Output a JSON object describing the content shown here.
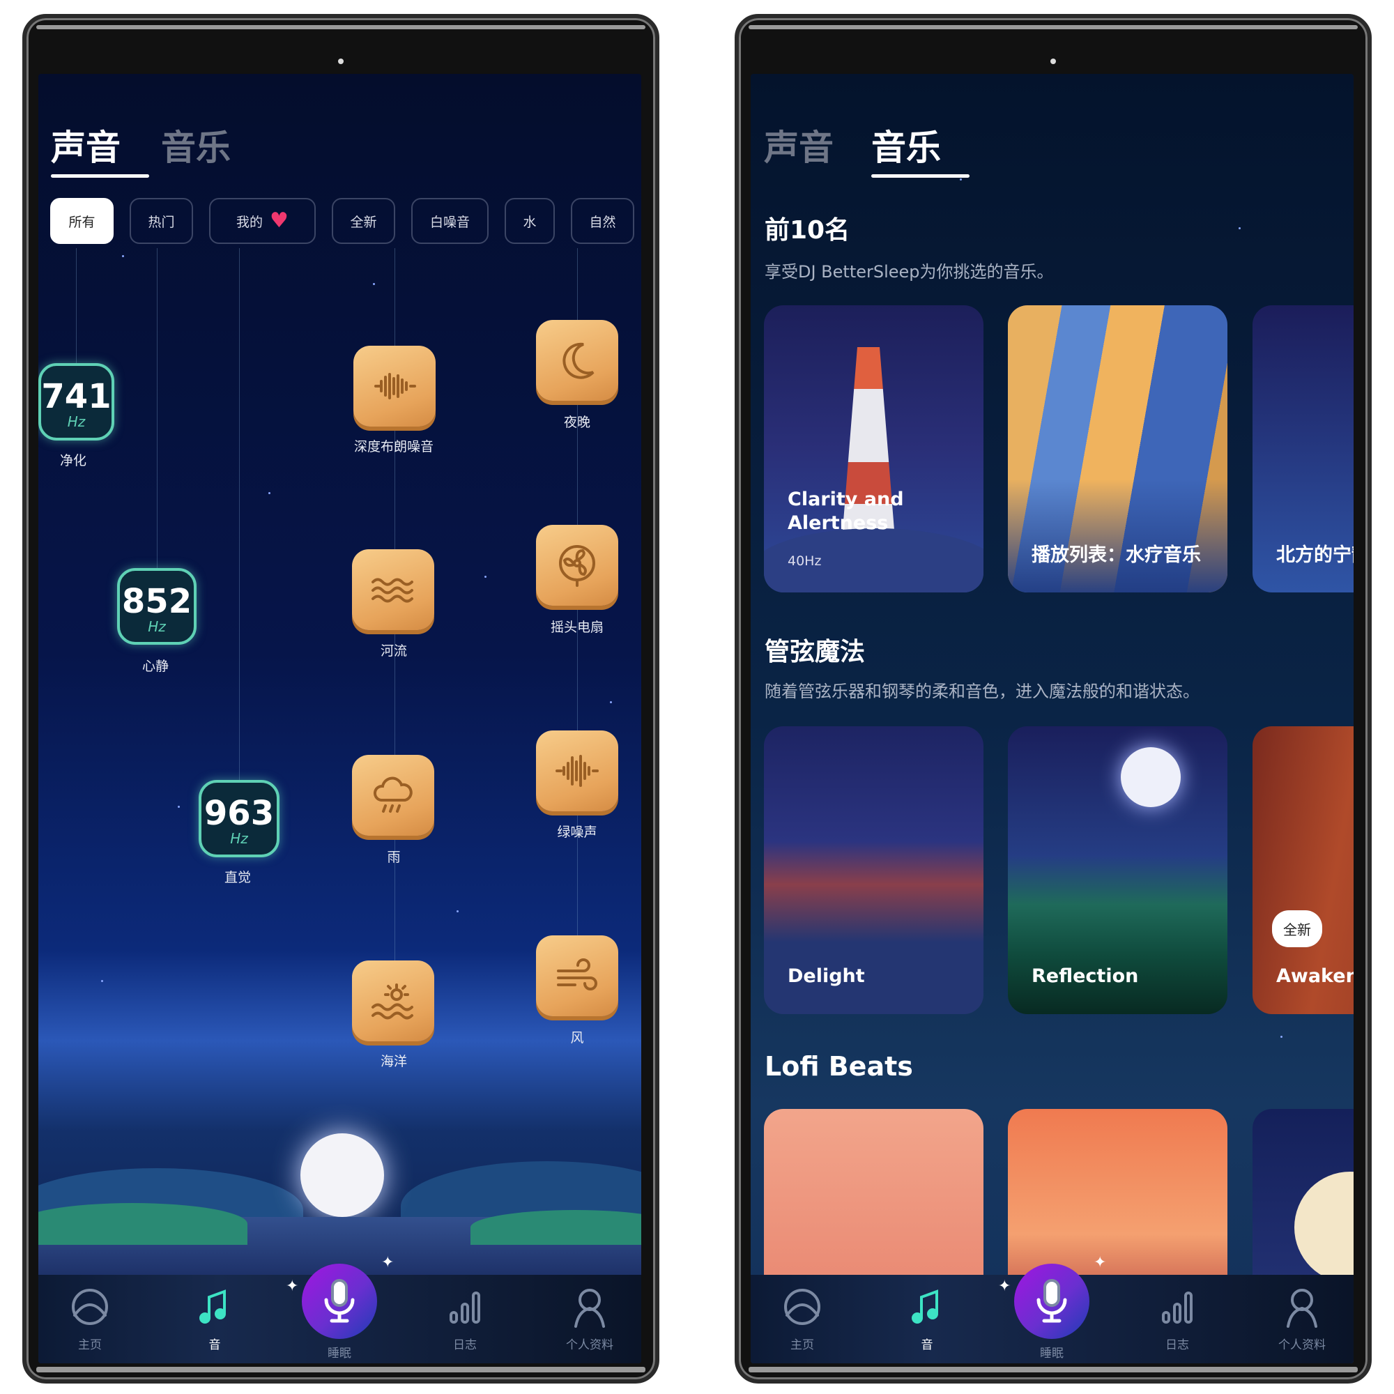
{
  "left": {
    "tabs": [
      {
        "label": "声音",
        "active": true
      },
      {
        "label": "音乐",
        "active": false
      }
    ],
    "filters": [
      {
        "label": "所有",
        "active": true
      },
      {
        "label": "热门"
      },
      {
        "label": "我的",
        "icon": "heart-icon"
      },
      {
        "label": "全新"
      },
      {
        "label": "白噪音"
      },
      {
        "label": "水"
      },
      {
        "label": "自然"
      }
    ],
    "frequencies": [
      {
        "value": "741",
        "unit": "Hz",
        "label": "净化"
      },
      {
        "value": "852",
        "unit": "Hz",
        "label": "心静"
      },
      {
        "value": "963",
        "unit": "Hz",
        "label": "直觉"
      }
    ],
    "sounds": [
      {
        "label": "深度布朗噪音",
        "icon": "sound-wave-icon"
      },
      {
        "label": "夜晚",
        "icon": "moon-icon"
      },
      {
        "label": "河流",
        "icon": "waves-icon"
      },
      {
        "label": "摇头电扇",
        "icon": "fan-icon"
      },
      {
        "label": "雨",
        "icon": "rain-cloud-icon"
      },
      {
        "label": "绿噪声",
        "icon": "noise-wave-icon"
      },
      {
        "label": "海洋",
        "icon": "ocean-sun-icon"
      },
      {
        "label": "风",
        "icon": "wind-icon"
      }
    ]
  },
  "right": {
    "tabs": [
      {
        "label": "声音",
        "active": false
      },
      {
        "label": "音乐",
        "active": true
      }
    ],
    "sections": [
      {
        "title": "前10名",
        "subtitle": "享受DJ BetterSleep为你挑选的音乐。",
        "cards": [
          {
            "title": "Clarity and Alertness",
            "meta": "40Hz"
          },
          {
            "title": "播放列表：水疗音乐"
          },
          {
            "title": "北方的宁静"
          }
        ]
      },
      {
        "title": "管弦魔法",
        "subtitle": "随着管弦乐器和钢琴的柔和音色，进入魔法般的和谐状态。",
        "cards": [
          {
            "title": "Delight"
          },
          {
            "title": "Reflection"
          },
          {
            "title": "Awaken",
            "badge": "全新"
          }
        ]
      },
      {
        "title": "Lofi Beats",
        "subtitle": "",
        "cards": []
      }
    ]
  },
  "nav": [
    {
      "label": "主页",
      "icon": "home-icon"
    },
    {
      "label": "音",
      "icon": "music-note-icon",
      "active": true
    },
    {
      "label": "睡眠",
      "icon": "microphone-icon"
    },
    {
      "label": "日志",
      "icon": "bar-chart-icon"
    },
    {
      "label": "个人资料",
      "icon": "profile-icon"
    }
  ],
  "colors": {
    "accent": "#3de3c4",
    "frequency_border": "#5fd1b5",
    "heart": "#f0386f",
    "mic_gradient_start": "#a116e0",
    "mic_gradient_end": "#1d3cb5",
    "wood": "#e7a45b"
  }
}
